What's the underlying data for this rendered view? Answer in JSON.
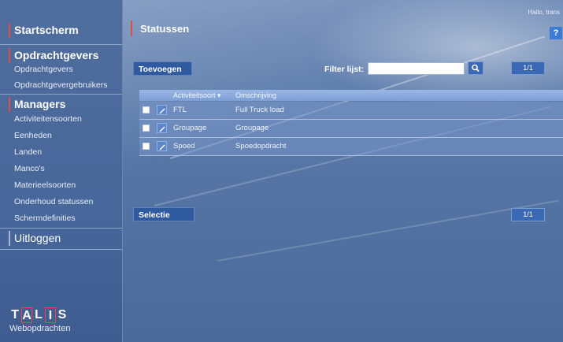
{
  "header": {
    "greeting": "Hallo, trans",
    "page_title": "Statussen",
    "help_label": "?"
  },
  "sidebar": {
    "startscherm": "Startscherm",
    "opdrachtgevers": {
      "heading": "Opdrachtgevers",
      "items": [
        "Opdrachtgevers",
        "Opdrachtgevergebruikers"
      ]
    },
    "managers": {
      "heading": "Managers",
      "items": [
        "Activiteitensoorten",
        "Eenheden",
        "Landen",
        "Manco's",
        "Materieelsoorten",
        "Onderhoud statussen",
        "Schermdefinities"
      ]
    },
    "uitloggen": "Uitloggen",
    "logo": {
      "letters": [
        "T",
        "A",
        "L",
        "I",
        "S"
      ],
      "subtitle": "Webopdrachten"
    }
  },
  "toolbar": {
    "add_label": "Toevoegen",
    "filter_label": "Filter lijst:",
    "filter_value": "",
    "pager_top": "1/1"
  },
  "table": {
    "columns": [
      "Activiteitsoort ▾",
      "Omschrijving"
    ],
    "rows": [
      {
        "activiteitsoort": "FTL",
        "omschrijving": "Full Truck load"
      },
      {
        "activiteitsoort": "Groupage",
        "omschrijving": "Groupage"
      },
      {
        "activiteitsoort": "Spoed",
        "omschrijving": "Spoedopdracht"
      }
    ]
  },
  "footer": {
    "selection_label": "Selectie",
    "pager_bottom": "1/1"
  },
  "colors": {
    "accent_red": "#e24a4a",
    "button_blue": "#2f5aa0",
    "background": "#4d6a96"
  }
}
